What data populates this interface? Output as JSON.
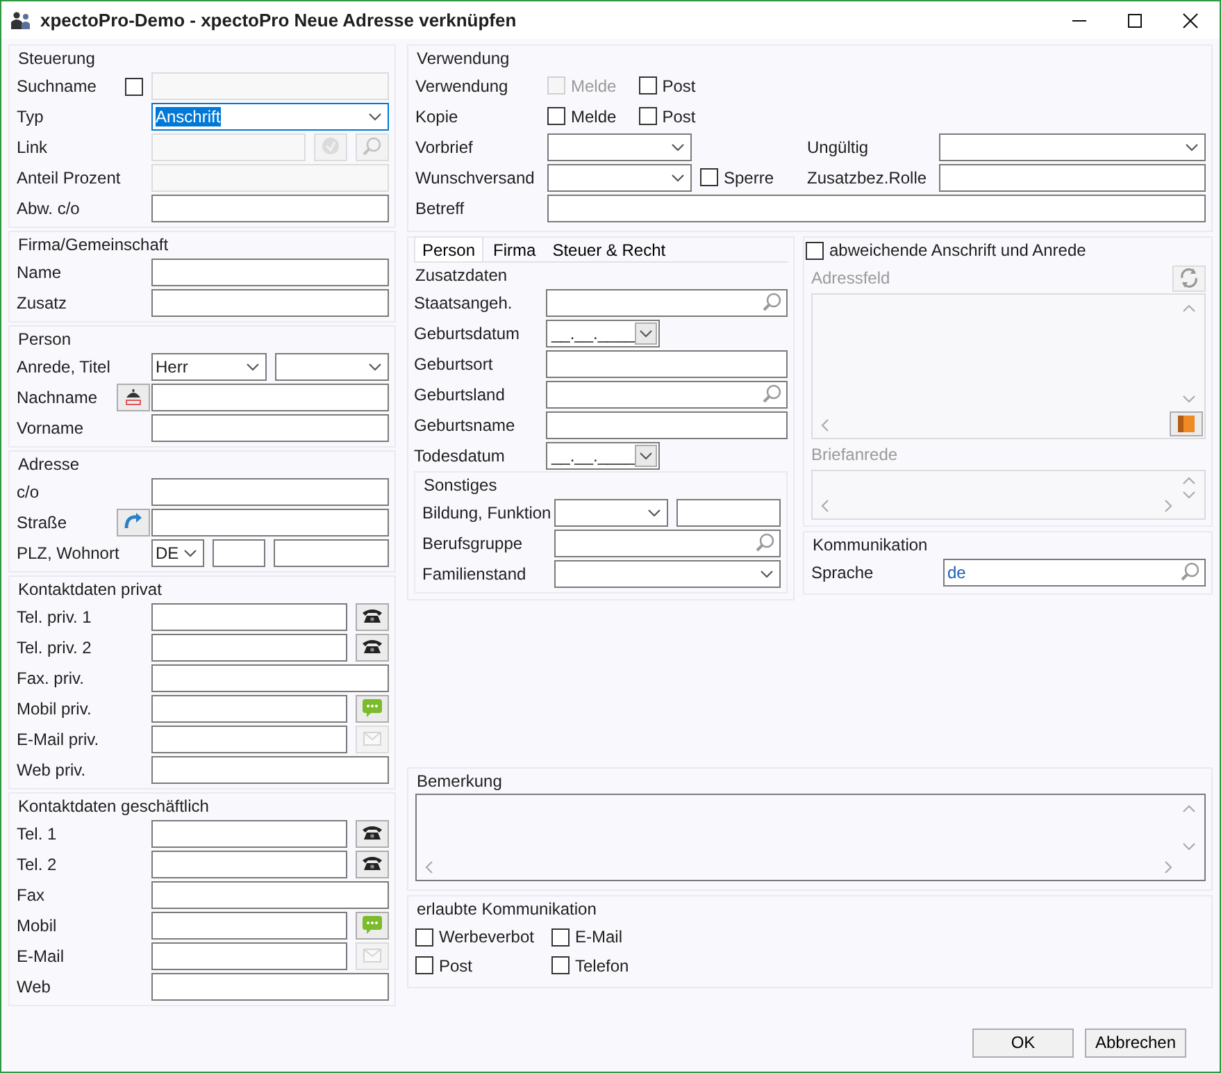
{
  "window": {
    "title": "xpectoPro-Demo - xpectoPro Neue Adresse verknüpfen"
  },
  "left_groups": [
    {
      "title": "Steuerung",
      "rows": [
        {
          "label": "Suchname",
          "slot": {
            "kind": "checkbox",
            "checked": false,
            "disabled": false
          },
          "controls": [
            {
              "kind": "field",
              "disabled": true
            }
          ]
        },
        {
          "label": "Typ",
          "controls": [
            {
              "kind": "select",
              "value": "Anschrift",
              "highlighted": true
            }
          ]
        },
        {
          "label": "Link",
          "controls": [
            {
              "kind": "field",
              "disabled": true
            },
            {
              "kind": "link-button",
              "disabled": true
            },
            {
              "kind": "search-button",
              "disabled": true
            }
          ]
        },
        {
          "label": "Anteil Prozent",
          "controls": [
            {
              "kind": "field",
              "disabled": true
            }
          ]
        },
        {
          "label": "Abw. c/o",
          "controls": [
            {
              "kind": "field"
            }
          ]
        }
      ]
    },
    {
      "title": "Firma/Gemeinschaft",
      "rows": [
        {
          "label": "Name",
          "controls": [
            {
              "kind": "field"
            }
          ]
        },
        {
          "label": "Zusatz",
          "controls": [
            {
              "kind": "field"
            }
          ]
        }
      ]
    },
    {
      "title": "Person",
      "rows": [
        {
          "label": "Anrede, Titel",
          "controls": [
            {
              "kind": "select",
              "value": "Herr"
            },
            {
              "kind": "select"
            }
          ]
        },
        {
          "label": "Nachname",
          "slot": {
            "kind": "person-button"
          },
          "controls": [
            {
              "kind": "field"
            }
          ]
        },
        {
          "label": "Vorname",
          "controls": [
            {
              "kind": "field"
            }
          ]
        }
      ]
    },
    {
      "title": "Adresse",
      "rows": [
        {
          "label": "c/o",
          "controls": [
            {
              "kind": "field"
            }
          ]
        },
        {
          "label": "Straße",
          "slot": {
            "kind": "swap-button"
          },
          "controls": [
            {
              "kind": "field"
            }
          ]
        },
        {
          "label": "PLZ, Wohnort",
          "controls": [
            {
              "kind": "tiny-select",
              "value": "DE"
            },
            {
              "kind": "short-field"
            },
            {
              "kind": "field"
            }
          ]
        }
      ]
    },
    {
      "title": "Kontaktdaten privat",
      "rows": [
        {
          "label": "Tel. priv. 1",
          "controls": [
            {
              "kind": "field"
            },
            {
              "kind": "phone-button",
              "disabled": false
            }
          ]
        },
        {
          "label": "Tel. priv. 2",
          "controls": [
            {
              "kind": "field"
            },
            {
              "kind": "phone-button",
              "disabled": false
            }
          ]
        },
        {
          "label": "Fax. priv.",
          "controls": [
            {
              "kind": "field"
            }
          ]
        },
        {
          "label": "Mobil priv.",
          "controls": [
            {
              "kind": "field"
            },
            {
              "kind": "sms-button",
              "disabled": false
            }
          ]
        },
        {
          "label": "E-Mail priv.",
          "controls": [
            {
              "kind": "field"
            },
            {
              "kind": "mail-button",
              "disabled": true
            }
          ]
        },
        {
          "label": "Web priv.",
          "controls": [
            {
              "kind": "field"
            }
          ]
        }
      ]
    },
    {
      "title": "Kontaktdaten geschäftlich",
      "rows": [
        {
          "label": "Tel. 1",
          "controls": [
            {
              "kind": "field"
            },
            {
              "kind": "phone-button",
              "disabled": false
            }
          ]
        },
        {
          "label": "Tel. 2",
          "controls": [
            {
              "kind": "field"
            },
            {
              "kind": "phone-button",
              "disabled": false
            }
          ]
        },
        {
          "label": "Fax",
          "controls": [
            {
              "kind": "field"
            }
          ]
        },
        {
          "label": "Mobil",
          "controls": [
            {
              "kind": "field"
            },
            {
              "kind": "sms-button",
              "disabled": false
            }
          ]
        },
        {
          "label": "E-Mail",
          "controls": [
            {
              "kind": "field"
            },
            {
              "kind": "mail-button",
              "disabled": true
            }
          ]
        },
        {
          "label": "Web",
          "controls": [
            {
              "kind": "field"
            }
          ]
        }
      ]
    }
  ],
  "usage": {
    "title": "Verwendung",
    "rows": [
      {
        "label": "Verwendung",
        "controls": [
          {
            "kind": "checkbox",
            "label": "Melde",
            "checked": false,
            "disabled": true
          },
          {
            "kind": "checkbox",
            "label": "Post",
            "checked": false,
            "disabled": false
          }
        ]
      },
      {
        "label": "Kopie",
        "controls": [
          {
            "kind": "checkbox",
            "label": "Melde",
            "checked": false,
            "disabled": false
          },
          {
            "kind": "checkbox",
            "label": "Post",
            "checked": false,
            "disabled": false
          }
        ]
      },
      {
        "label": "Vorbrief",
        "controls": [
          {
            "kind": "short-select"
          }
        ],
        "right": {
          "label": "Ungültig",
          "controls": [
            {
              "kind": "select"
            }
          ]
        }
      },
      {
        "label": "Wunschversand",
        "controls": [
          {
            "kind": "short-select"
          },
          {
            "kind": "checkbox",
            "label": "Sperre",
            "checked": false,
            "disabled": false
          }
        ],
        "right": {
          "label": "Zusatzbez.Rolle",
          "controls": [
            {
              "kind": "field"
            }
          ]
        }
      },
      {
        "label": "Betreff",
        "controls": [
          {
            "kind": "field"
          }
        ]
      }
    ]
  },
  "detail_tabs": [
    {
      "label": "Person",
      "selected": true
    },
    {
      "label": "Firma",
      "selected": false
    },
    {
      "label": "Steuer & Recht",
      "selected": false
    }
  ],
  "person_groups": [
    {
      "title": "Zusatzdaten",
      "rows": [
        {
          "label": "Staatsangeh.",
          "controls": [
            {
              "kind": "search-field"
            }
          ]
        },
        {
          "label": "Geburtsdatum",
          "controls": [
            {
              "kind": "date-field",
              "value": "__.__.____"
            }
          ]
        },
        {
          "label": "Geburtsort",
          "controls": [
            {
              "kind": "field"
            }
          ]
        },
        {
          "label": "Geburtsland",
          "controls": [
            {
              "kind": "search-field"
            }
          ]
        },
        {
          "label": "Geburtsname",
          "controls": [
            {
              "kind": "field"
            }
          ]
        },
        {
          "label": "Todesdatum",
          "controls": [
            {
              "kind": "date-field",
              "value": "__.__.____"
            }
          ]
        }
      ]
    },
    {
      "title": "Sonstiges",
      "rows": [
        {
          "label": "Bildung, Funktion",
          "controls": [
            {
              "kind": "mid-select"
            },
            {
              "kind": "field"
            }
          ]
        },
        {
          "label": "Berufsgruppe",
          "controls": [
            {
              "kind": "search-field"
            }
          ]
        },
        {
          "label": "Familienstand",
          "controls": [
            {
              "kind": "select"
            }
          ]
        }
      ]
    }
  ],
  "address_panel": {
    "toggle": {
      "label": "abweichende Anschrift und Anrede",
      "checked": false
    },
    "address_field": {
      "label": "Adressfeld",
      "disabled": true
    },
    "salutation_field": {
      "label": "Briefanrede",
      "disabled": true
    }
  },
  "communication": {
    "title": "Kommunikation",
    "rows": [
      {
        "label": "Sprache",
        "controls": [
          {
            "kind": "search-field",
            "value": "de"
          }
        ]
      }
    ]
  },
  "remark": {
    "title": "Bemerkung"
  },
  "allowed": {
    "title": "erlaubte Kommunikation",
    "options": [
      {
        "label": "Werbeverbot",
        "checked": false
      },
      {
        "label": "E-Mail",
        "checked": false
      },
      {
        "label": "Post",
        "checked": false
      },
      {
        "label": "Telefon",
        "checked": false
      }
    ]
  },
  "buttons": [
    {
      "label": "OK"
    },
    {
      "label": "Abbrechen"
    }
  ]
}
